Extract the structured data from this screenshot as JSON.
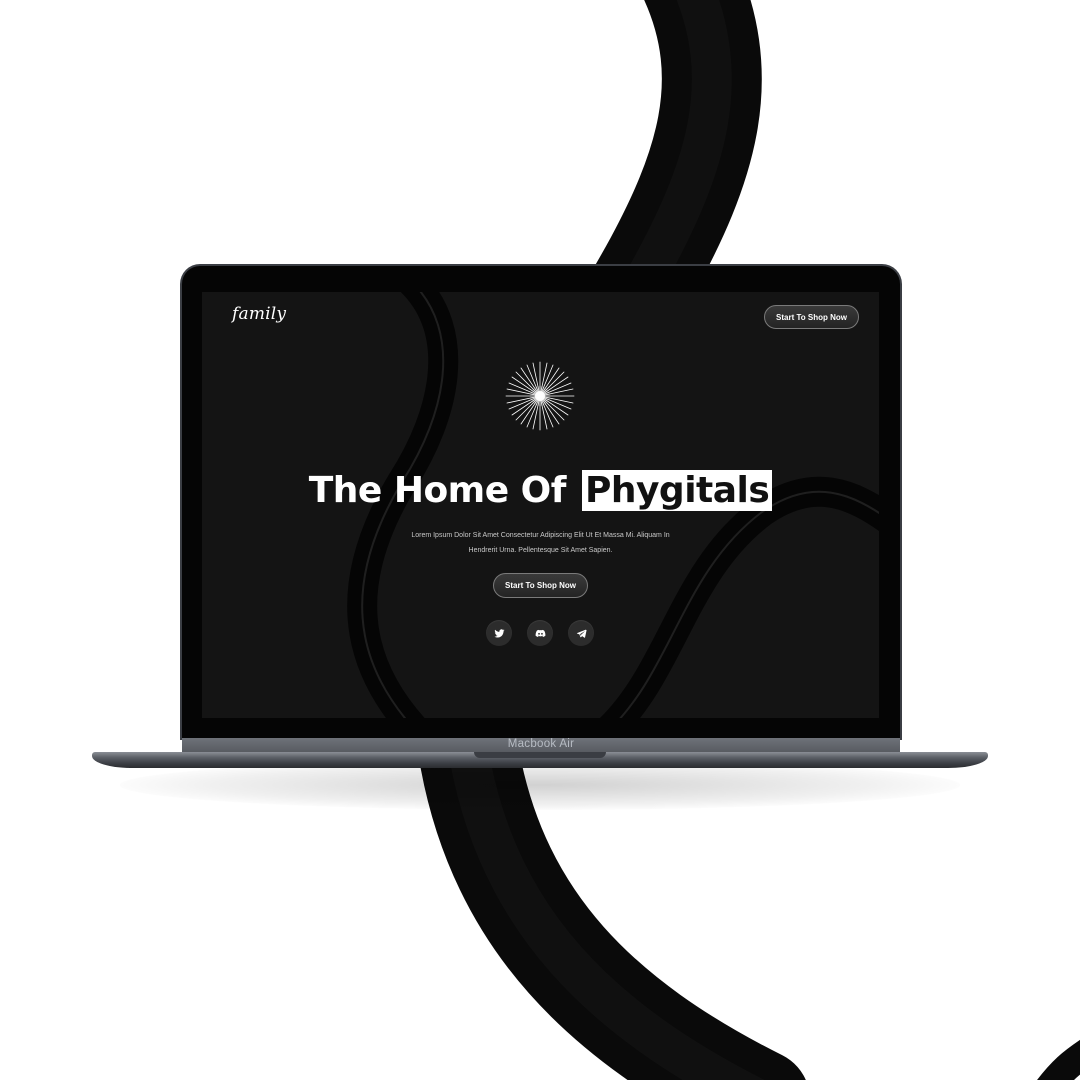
{
  "site": {
    "logo": "family",
    "header_button": "Start To Shop Now",
    "headline_prefix": "The Home Of",
    "headline_highlight": "Phygitals",
    "description_line1": "Lorem Ipsum Dolor Sit Amet Consectetur Adipiscing Elit Ut Et Massa Mi. Aliquam In",
    "description_line2": "Hendrerit Urna. Pellentesque Sit Amet Sapien.",
    "cta_button": "Start To Shop Now",
    "socials": [
      "twitter-icon",
      "discord-icon",
      "telegram-icon"
    ]
  },
  "device": {
    "label": "Macbook Air"
  },
  "colors": {
    "background": "#ffffff",
    "screen": "#141414",
    "text": "#ffffff",
    "highlight_bg": "#ffffff",
    "highlight_text": "#111111",
    "tube": "#0b0b0b"
  }
}
